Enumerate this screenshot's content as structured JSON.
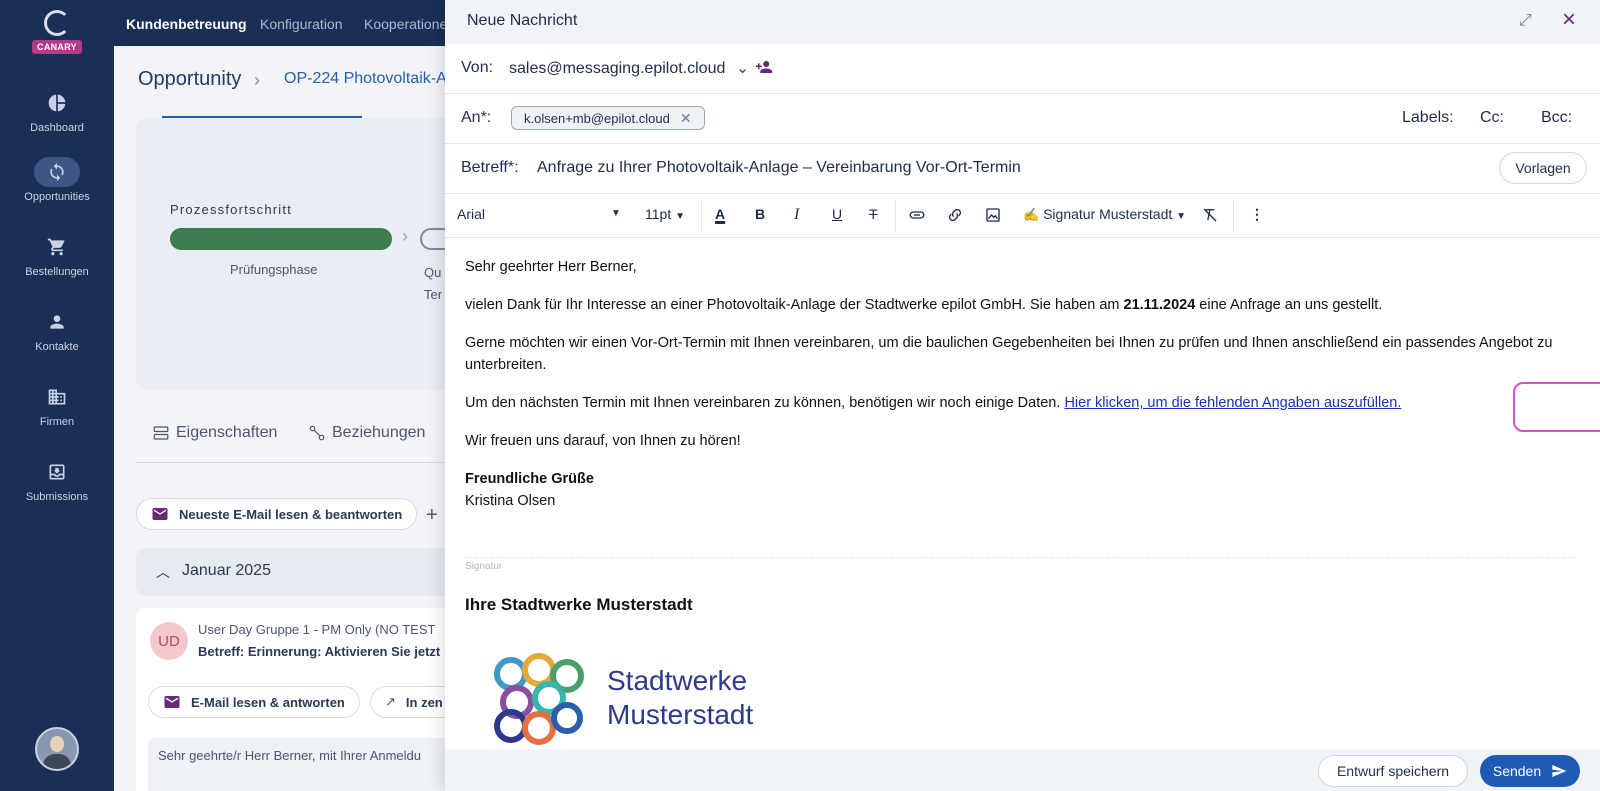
{
  "sidebar": {
    "badge": "CANARY",
    "items": [
      {
        "label": "Dashboard",
        "icon": "pie-chart-icon"
      },
      {
        "label": "Opportunities",
        "icon": "sync-icon",
        "active": true
      },
      {
        "label": "Bestellungen",
        "icon": "cart-icon"
      },
      {
        "label": "Kontakte",
        "icon": "person-icon"
      },
      {
        "label": "Firmen",
        "icon": "building-icon"
      },
      {
        "label": "Submissions",
        "icon": "inbox-icon"
      }
    ]
  },
  "topnav": {
    "items": [
      "Kundenbetreuung",
      "Konfiguration",
      "Kooperationen"
    ]
  },
  "page": {
    "title": "Opportunity",
    "breadcrumb": "OP-224 Photovoltaik-A",
    "process_label": "Prozessfortschritt",
    "phase": "Prüfungsphase",
    "next_phase_1": "Qu",
    "next_phase_2": "Ter",
    "tabs": [
      "Eigenschaften",
      "Beziehungen"
    ],
    "action_pill": "Neueste E-Mail lesen & beantworten",
    "month": "Januar 2025",
    "feed": {
      "initials": "UD",
      "line1": "User Day Gruppe 1 - PM Only (NO TEST",
      "line2": "Betreff: Erinnerung: Aktivieren Sie jetzt",
      "btn_read": "E-Mail lesen & antworten",
      "btn_open": "In zen",
      "preview": "Sehr geehrte/r Herr Berner, mit Ihrer Anmeldu"
    }
  },
  "modal": {
    "title": "Neue Nachricht",
    "from_label": "Von:",
    "from_value": "sales@messaging.epilot.cloud",
    "to_label": "An*:",
    "to_chip": "k.olsen+mb@epilot.cloud",
    "labels_label": "Labels:",
    "cc_label": "Cc:",
    "bcc_label": "Bcc:",
    "subject_label": "Betreff*:",
    "subject_value": "Anfrage zu Ihrer Photovoltaik-Anlage – Vereinbarung Vor-Ort-Termin",
    "templates_button": "Vorlagen",
    "toolbar": {
      "font": "Arial",
      "size": "11pt",
      "signature": "Signatur Musterstadt"
    },
    "body": {
      "greeting": "Sehr geehrter Herr Berner,",
      "p1_a": "vielen Dank für Ihr Interesse an einer Photovoltaik-Anlage der Stadtwerke epilot GmbH. Sie haben am ",
      "p1_date": "21.11.2024",
      "p1_b": " eine Anfrage an uns gestellt.",
      "p2_line1": "Gerne möchten wir einen Vor-Ort-Termin mit Ihnen vereinbaren, um die baulichen Gegebenheiten bei Ihnen zu prüfen und Ihnen anschließend ein passendes Angebot zu",
      "p2_line2": "unterbreiten.",
      "p3_text": "Um den nächsten Termin mit Ihnen vereinbaren zu können, benötigen wir noch einige Daten. ",
      "p3_link": "Hier klicken, um die fehlenden Angaben auszufüllen.",
      "p4": "Wir freuen uns darauf, von Ihnen zu hören!",
      "closing": "Freundliche Grüße",
      "sender": "Kristina Olsen",
      "signature_label": "Signatur",
      "signature_name": "Ihre Stadtwerke Musterstadt",
      "logo_line1": "Stadtwerke",
      "logo_line2": "Musterstadt"
    },
    "footer": {
      "draft_button": "Entwurf speichern",
      "send_button": "Senden"
    }
  },
  "colors": {
    "sidebar_bg": "#1a2f56",
    "accent_purple": "#6b2a78",
    "send_blue": "#1f5bb5",
    "highlight_pink": "#e34cc9",
    "progress_green": "#3e7b4f"
  }
}
